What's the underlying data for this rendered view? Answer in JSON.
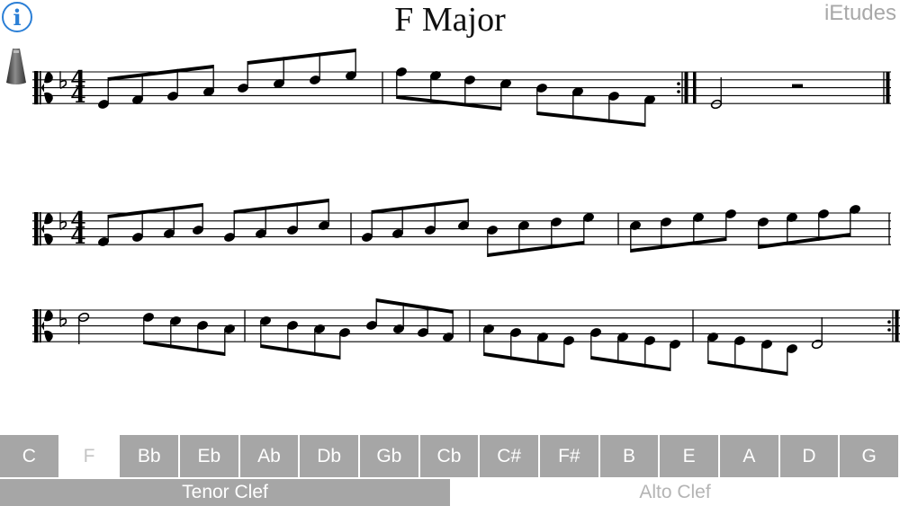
{
  "header": {
    "info_label": "i",
    "title": "F Major",
    "brand": "iEtudes"
  },
  "score": {
    "clef": "C clef (tenor)",
    "key_signature": "one flat",
    "time_signature": {
      "top": "4",
      "bottom": "4"
    }
  },
  "key_tabs": [
    {
      "label": "C",
      "selected": false
    },
    {
      "label": "F",
      "selected": true
    },
    {
      "label": "Bb",
      "selected": false
    },
    {
      "label": "Eb",
      "selected": false
    },
    {
      "label": "Ab",
      "selected": false
    },
    {
      "label": "Db",
      "selected": false
    },
    {
      "label": "Gb",
      "selected": false
    },
    {
      "label": "Cb",
      "selected": false
    },
    {
      "label": "C#",
      "selected": false
    },
    {
      "label": "F#",
      "selected": false
    },
    {
      "label": "B",
      "selected": false
    },
    {
      "label": "E",
      "selected": false
    },
    {
      "label": "A",
      "selected": false
    },
    {
      "label": "D",
      "selected": false
    },
    {
      "label": "G",
      "selected": false
    }
  ],
  "clef_tabs": {
    "tenor": "Tenor Clef",
    "alto": "Alto Clef",
    "selected": "tenor"
  },
  "colors": {
    "tab_active": "#a6a6a6",
    "tab_text": "#ffffff",
    "selected_text": "#c4c4c4",
    "info_blue": "#2b7fd6"
  }
}
